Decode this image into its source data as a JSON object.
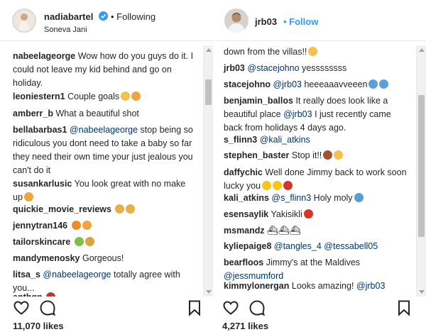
{
  "left": {
    "username": "nadiabartel",
    "follow_label": "• Following",
    "location": "Soneva Jani",
    "likes": "11,070 likes",
    "comments": [
      {
        "user": "nabeelageorge",
        "parts": [
          {
            "t": "Wow how do you guys do it. I could not leave my kid behind and go on holiday."
          }
        ]
      },
      {
        "user": "leoniestern1",
        "parts": [
          {
            "t": "Couple goals"
          }
        ],
        "emoji": [
          "#f2c14e",
          "#f0a43c"
        ]
      },
      {
        "user": "amberr_b",
        "parts": [
          {
            "t": "What a beautiful shot"
          }
        ]
      },
      {
        "user": "bellabarbas1",
        "parts": [
          {
            "m": "@nabeelageorge"
          },
          {
            "t": " stop being so ridiculous you dont need to take a baby so far they need their own time your just jealous you can't do it"
          }
        ]
      },
      {
        "user": "susankarlusic",
        "parts": [
          {
            "t": "You look great with no make up"
          }
        ],
        "emoji": [
          "#f0a43c"
        ]
      },
      {
        "user": "quickie_movie_reviews",
        "parts": [],
        "emoji": [
          "#e8b04a",
          "#e8b04a"
        ]
      },
      {
        "user": "jennytran146",
        "parts": [],
        "emoji": [
          "#f08a2a",
          "#f0a43c"
        ]
      },
      {
        "user": "tailorskincare",
        "parts": [],
        "emoji": [
          "#7cbf4a",
          "#d9a441"
        ]
      },
      {
        "user": "mandymenosky",
        "parts": [
          {
            "t": "Gorgeous!"
          }
        ]
      },
      {
        "user": "litsa_s",
        "parts": [
          {
            "m": "@nabeelageorge"
          },
          {
            "t": " totally agree with you..."
          }
        ]
      },
      {
        "user": "anthgn",
        "parts": [],
        "emoji": [
          "#c0392b"
        ]
      }
    ]
  },
  "right": {
    "username": "jrb03",
    "follow_label": "• Follow",
    "likes": "4,271 likes",
    "comments": [
      {
        "user": "",
        "parts": [
          {
            "t": "down from the villas!!"
          }
        ],
        "emoji": [
          "#f2c14e"
        ]
      },
      {
        "user": "jrb03",
        "parts": [
          {
            "m": "@stacejohno"
          },
          {
            "t": " yessssssss"
          }
        ]
      },
      {
        "user": "stacejohno",
        "parts": [
          {
            "m": "@jrb03"
          },
          {
            "t": " heeeaaavveeen"
          }
        ],
        "emoji": [
          "#5aa0d8",
          "#5aa0d8"
        ]
      },
      {
        "user": "benjamin_ballos",
        "parts": [
          {
            "t": "It really does look like a beautiful place "
          },
          {
            "m": "@jrb03"
          },
          {
            "t": " I just recently came back from holidays 4 days ago."
          }
        ]
      },
      {
        "user": "s_flinn3",
        "parts": [
          {
            "m": "@kali_atkins"
          }
        ]
      },
      {
        "user": "stephen_baster",
        "parts": [
          {
            "t": "Stop it!!"
          }
        ],
        "emoji": [
          "#a0522d",
          "#f2c14e"
        ]
      },
      {
        "user": "daffychic",
        "parts": [
          {
            "t": "Well done Jimmy back to work soon lucky you"
          }
        ],
        "emoji": [
          "#f5c518",
          "#f5c518",
          "#d9342b"
        ]
      },
      {
        "user": "kali_atkins",
        "parts": [
          {
            "m": "@s_flinn3"
          },
          {
            "t": " Holy moly"
          }
        ],
        "emoji": [
          "#5aa0d8"
        ]
      },
      {
        "user": "esensaylik",
        "parts": [
          {
            "t": "Yakisikli"
          }
        ],
        "emoji": [
          "#d9342b"
        ]
      },
      {
        "user": "msmandz",
        "parts": [
          {
            "t": "⛴⛴⛴"
          }
        ]
      },
      {
        "user": "kyliepaige8",
        "parts": [
          {
            "m": "@tangles_4"
          },
          {
            "t": " "
          },
          {
            "m": "@tessabell05"
          }
        ]
      },
      {
        "user": "bearfloos",
        "parts": [
          {
            "t": "Jimmy's at the Maldives "
          },
          {
            "m": "@jessmumford"
          }
        ]
      },
      {
        "user": "kimmylonergan",
        "parts": [
          {
            "t": "Looks amazing! "
          },
          {
            "m": "@jrb03"
          }
        ]
      }
    ]
  },
  "icons": [
    "heart-icon",
    "comment-icon",
    "bookmark-icon",
    "verified-badge-icon"
  ],
  "colors": {
    "text": "#262626",
    "mention": "#003569",
    "follow": "#3897f0",
    "verified": "#3897f0",
    "border": "#e6e6e6"
  }
}
